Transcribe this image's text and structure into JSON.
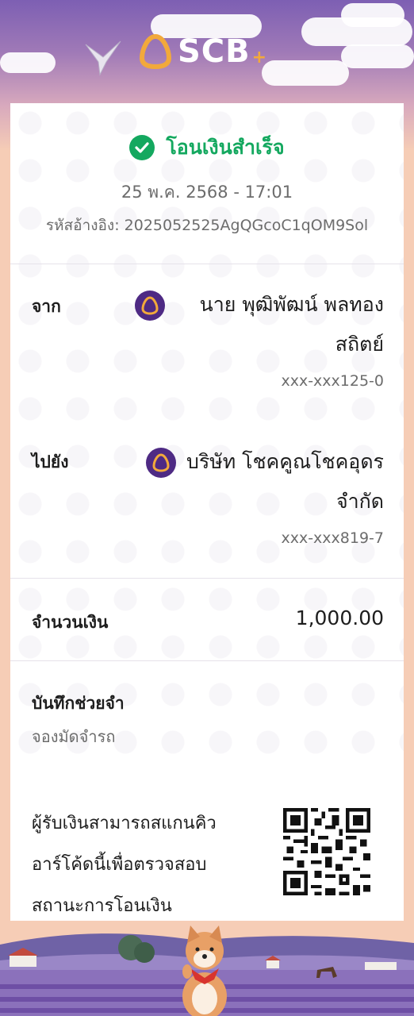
{
  "header": {
    "brand": "SCB",
    "brand_plus": "+"
  },
  "status": {
    "text": "โอนเงินสำเร็จ",
    "color": "#14a85f"
  },
  "transaction": {
    "datetime": "25 พ.ค. 2568 - 17:01",
    "reference": "รหัสอ้างอิง: 2025052525AgQGcoC1qOM9Sol"
  },
  "from": {
    "label": "จาก",
    "name_line1": "นาย พุฒิพัฒน์ พลทอง",
    "name_line2": "สถิตย์",
    "account": "xxx-xxx125-0",
    "bank_icon": "scb-bank-icon"
  },
  "to": {
    "label": "ไปยัง",
    "name_line1": "บริษัท โชคคูณโชคอุดร",
    "name_line2": "จำกัด",
    "account": "xxx-xxx819-7",
    "bank_icon": "scb-bank-icon"
  },
  "amount": {
    "label": "จำนวนเงิน",
    "value": "1,000.00"
  },
  "memo": {
    "label": "บันทึกช่วยจำ",
    "value": "จองมัดจำรถ"
  },
  "qr": {
    "line1": "ผู้รับเงินสามารถสแกนคิว",
    "line2": "อาร์โค้ดนี้เพื่อตรวจสอบ",
    "line3": "สถานะการโอนเงิน"
  },
  "colors": {
    "brand_purple": "#4e2a84",
    "accent_gold": "#f2a93b",
    "background": "#f6cdb6"
  }
}
